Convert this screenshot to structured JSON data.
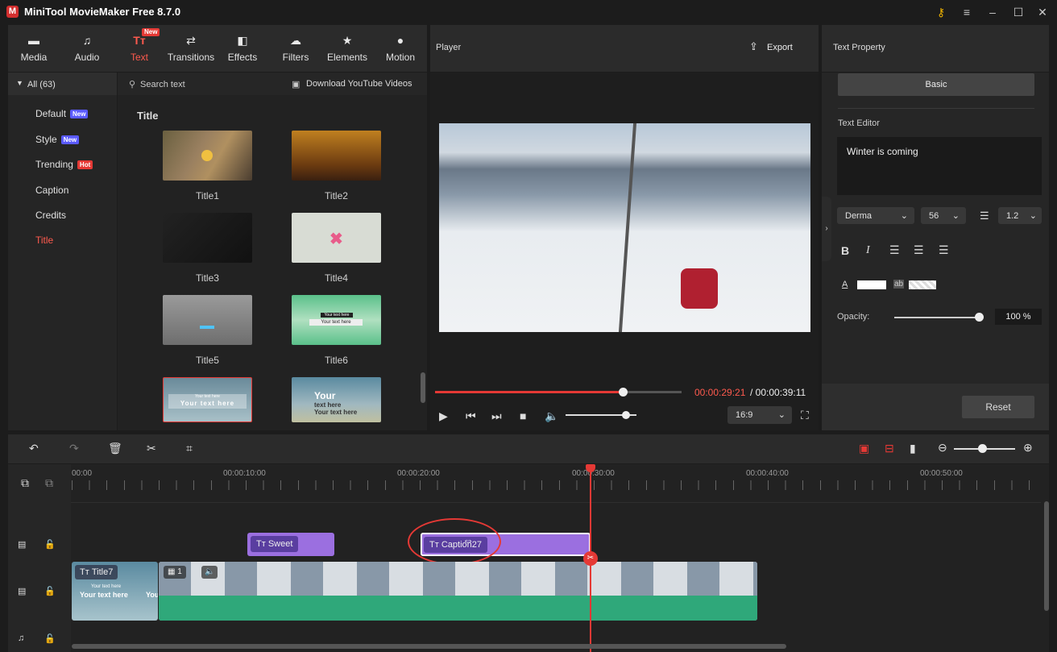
{
  "app": {
    "logo": "M",
    "title": "MiniTool MovieMaker Free 8.7.0"
  },
  "window_controls": [
    "key-icon",
    "menu-icon",
    "minimize-icon",
    "maximize-icon",
    "close-icon"
  ],
  "toolbar": {
    "items": [
      {
        "label": "Media",
        "icon": "media-icon"
      },
      {
        "label": "Audio",
        "icon": "audio-icon"
      },
      {
        "label": "Text",
        "icon": "text-icon",
        "badge": "New",
        "active": true
      },
      {
        "label": "Transitions",
        "icon": "transitions-icon"
      },
      {
        "label": "Effects",
        "icon": "effects-icon"
      },
      {
        "label": "Filters",
        "icon": "filters-icon"
      },
      {
        "label": "Elements",
        "icon": "elements-icon"
      },
      {
        "label": "Motion",
        "icon": "motion-icon"
      }
    ]
  },
  "categories": {
    "header": "All (63)",
    "items": [
      {
        "label": "Default",
        "badge": "New"
      },
      {
        "label": "Style",
        "badge": "New"
      },
      {
        "label": "Trending",
        "badge": "Hot"
      },
      {
        "label": "Caption"
      },
      {
        "label": "Credits"
      },
      {
        "label": "Title",
        "active": true
      }
    ]
  },
  "library": {
    "search_placeholder": "Search text",
    "download": "Download YouTube Videos",
    "section": "Title",
    "items": [
      "Title1",
      "Title2",
      "Title3",
      "Title4",
      "Title5",
      "Title6"
    ],
    "thumb5_text": {
      "line1": "Your text here",
      "line2": "Your text here"
    },
    "thumb6_text": {
      "line1": "Your text here",
      "line2": "Your text here"
    },
    "thumb7_text": {
      "line1": "Your text here",
      "line2": "Your text here"
    },
    "thumb8_text": {
      "line1": "Your",
      "line2": "text here",
      "line3": "Your text here"
    }
  },
  "player": {
    "title": "Player",
    "export": "Export",
    "current_time": "00:00:29:21",
    "total_time": " / 00:00:39:11",
    "progress": 0.76,
    "volume": 0.85,
    "aspect": "16:9"
  },
  "property": {
    "title": "Text Property",
    "tab": "Basic",
    "editor_label": "Text Editor",
    "text": "Winter is coming",
    "font": "Derma",
    "size": "56",
    "line_spacing": "1.2",
    "opacity_label": "Opacity:",
    "opacity_value": "100 %",
    "opacity": 1.0,
    "reset": "Reset"
  },
  "timeline": {
    "ruler": [
      "00:00",
      "00:00:10:00",
      "00:00:20:00",
      "00:00:30:00",
      "00:00:40:00",
      "00:00:50:00"
    ],
    "clips": {
      "sweet": "Sweet",
      "caption": "Caption27",
      "title7": "Title7",
      "title7_text1": "Your text here",
      "title7_text2": "Your text here",
      "title7_text3": "You",
      "video_count": "1"
    },
    "zoom": 0.46
  }
}
